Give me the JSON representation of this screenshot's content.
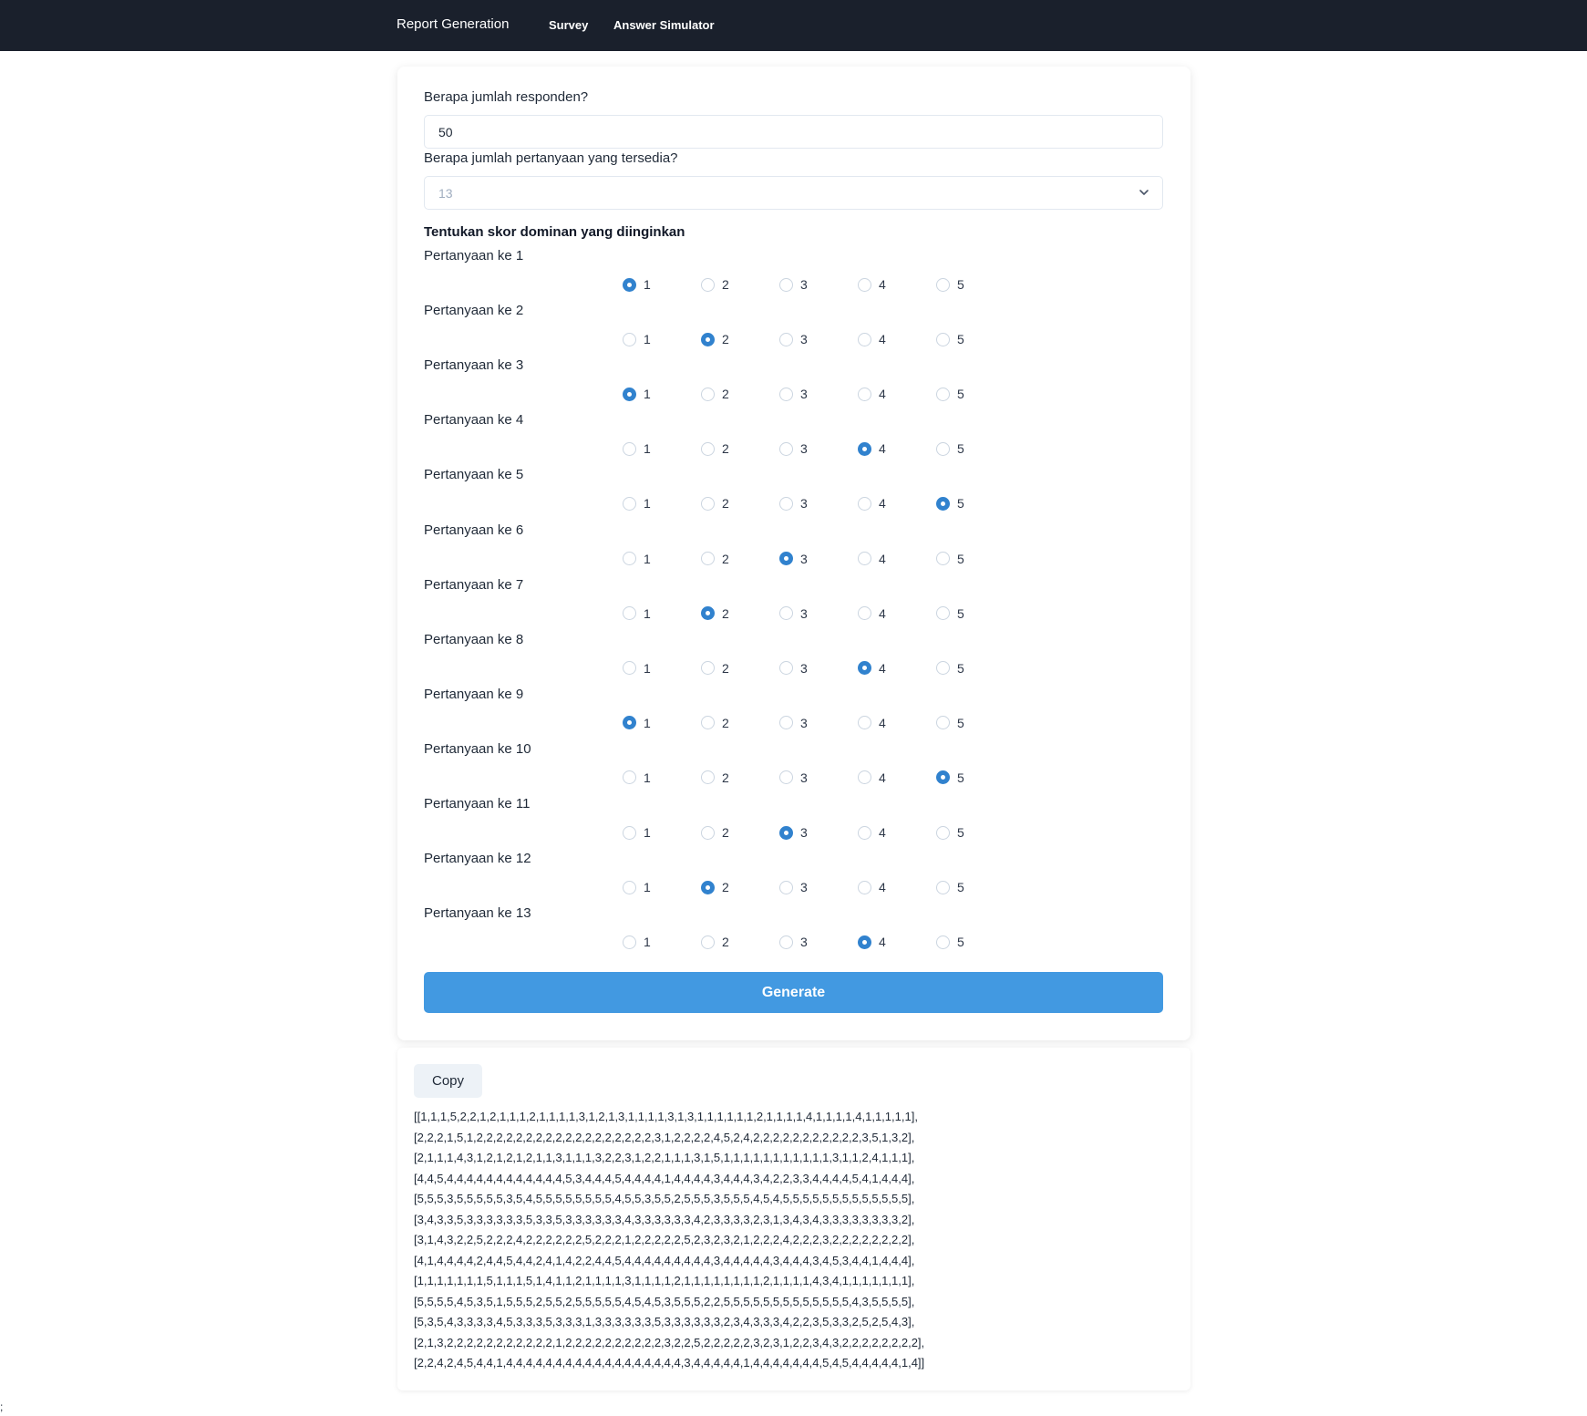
{
  "nav": {
    "brand": "Report Generation",
    "links": [
      "Survey",
      "Answer Simulator"
    ]
  },
  "form": {
    "respondents_label": "Berapa jumlah responden?",
    "respondents_value": "50",
    "questions_label": "Berapa jumlah pertanyaan yang tersedia?",
    "questions_selected": "13",
    "dominant_heading": "Tentukan skor dominan yang diinginkan",
    "options": [
      "1",
      "2",
      "3",
      "4",
      "5"
    ],
    "questions": [
      {
        "label": "Pertanyaan ke 1",
        "selected": "1"
      },
      {
        "label": "Pertanyaan ke 2",
        "selected": "2"
      },
      {
        "label": "Pertanyaan ke 3",
        "selected": "1"
      },
      {
        "label": "Pertanyaan ke 4",
        "selected": "4"
      },
      {
        "label": "Pertanyaan ke 5",
        "selected": "5"
      },
      {
        "label": "Pertanyaan ke 6",
        "selected": "3"
      },
      {
        "label": "Pertanyaan ke 7",
        "selected": "2"
      },
      {
        "label": "Pertanyaan ke 8",
        "selected": "4"
      },
      {
        "label": "Pertanyaan ke 9",
        "selected": "1"
      },
      {
        "label": "Pertanyaan ke 10",
        "selected": "5"
      },
      {
        "label": "Pertanyaan ke 11",
        "selected": "3"
      },
      {
        "label": "Pertanyaan ke 12",
        "selected": "2"
      },
      {
        "label": "Pertanyaan ke 13",
        "selected": "4"
      }
    ],
    "generate_label": "Generate"
  },
  "output": {
    "copy_label": "Copy",
    "lines": [
      "[[1,1,1,5,2,2,1,2,1,1,1,2,1,1,1,1,3,1,2,1,3,1,1,1,1,3,1,3,1,1,1,1,1,1,2,1,1,1,1,4,1,1,1,1,4,1,1,1,1,1],",
      "[2,2,2,1,5,1,2,2,2,2,2,2,2,2,2,2,2,2,2,2,2,2,2,2,3,1,2,2,2,2,4,5,2,4,2,2,2,2,2,2,2,2,2,2,2,3,5,1,3,2],",
      "[2,1,1,1,4,3,1,2,1,2,1,2,1,1,3,1,1,1,3,2,2,3,1,2,2,1,1,1,3,1,5,1,1,1,1,1,1,1,1,1,1,1,3,1,1,2,4,1,1,1],",
      "[4,4,5,4,4,4,4,4,4,4,4,4,4,4,4,5,3,4,4,4,5,4,4,4,4,1,4,4,4,4,3,4,4,4,3,4,2,2,3,3,4,4,4,4,5,4,1,4,4,4],",
      "[5,5,5,3,5,5,5,5,5,3,5,4,5,5,5,5,5,5,5,5,4,5,5,3,5,5,2,5,5,5,3,5,5,5,4,5,4,5,5,5,5,5,5,5,5,5,5,5,5,5],",
      "[3,4,3,3,5,3,3,3,3,3,3,5,3,3,5,3,3,3,3,3,3,4,3,3,3,3,3,3,4,2,3,3,3,3,2,3,1,3,4,3,4,3,3,3,3,3,3,3,3,2],",
      "[3,1,4,3,2,2,5,2,2,2,4,2,2,2,2,2,2,5,2,2,2,1,2,2,2,2,2,5,2,3,2,3,2,1,2,2,2,4,2,2,2,3,2,2,2,2,2,2,2,2],",
      "[4,1,4,4,4,4,2,4,4,5,4,4,2,4,1,4,2,2,4,4,5,4,4,4,4,4,4,4,4,4,3,4,4,4,4,4,3,4,4,4,3,4,5,3,4,4,1,4,4,4],",
      "[1,1,1,1,1,1,1,5,1,1,1,5,1,4,1,1,2,1,1,1,1,3,1,1,1,1,2,1,1,1,1,1,1,1,1,2,1,1,1,1,4,3,4,1,1,1,1,1,1,1],",
      "[5,5,5,5,4,5,3,5,1,5,5,5,2,5,5,2,5,5,5,5,5,4,5,4,5,3,5,5,5,2,2,5,5,5,5,5,5,5,5,5,5,5,5,5,4,3,5,5,5,5],",
      "[5,3,5,4,3,3,3,3,4,5,3,3,3,5,3,3,3,1,3,3,3,3,3,3,5,3,3,3,3,3,3,2,3,4,3,3,3,4,2,2,3,5,3,3,2,5,2,5,4,3],",
      "[2,1,3,2,2,2,2,2,2,2,2,2,2,2,1,2,2,2,2,2,2,2,2,2,2,3,2,2,5,2,2,2,2,2,3,2,3,1,2,2,3,4,3,2,2,2,2,2,2,2,2],",
      "[2,2,4,2,4,5,4,4,1,4,4,4,4,4,4,4,4,4,4,4,4,4,4,4,4,4,4,3,4,4,4,4,4,1,4,4,4,4,4,4,4,5,4,5,4,4,4,4,4,1,4]]"
    ]
  },
  "stray_char": ";"
}
